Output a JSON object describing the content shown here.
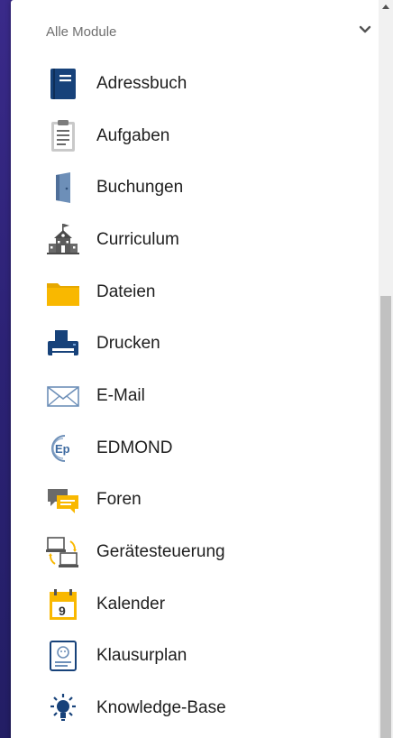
{
  "header": {
    "title": "Alle Module"
  },
  "modules": [
    {
      "label": "Adressbuch",
      "icon": "address-book-icon"
    },
    {
      "label": "Aufgaben",
      "icon": "clipboard-icon"
    },
    {
      "label": "Buchungen",
      "icon": "door-icon"
    },
    {
      "label": "Curriculum",
      "icon": "school-building-icon"
    },
    {
      "label": "Dateien",
      "icon": "folder-icon"
    },
    {
      "label": "Drucken",
      "icon": "printer-icon"
    },
    {
      "label": "E-Mail",
      "icon": "envelope-icon"
    },
    {
      "label": "EDMOND",
      "icon": "edmond-logo-icon"
    },
    {
      "label": "Foren",
      "icon": "chat-bubbles-icon"
    },
    {
      "label": "Gerätesteuerung",
      "icon": "device-control-icon"
    },
    {
      "label": "Kalender",
      "icon": "calendar-icon"
    },
    {
      "label": "Klausurplan",
      "icon": "exam-plan-icon"
    },
    {
      "label": "Knowledge-Base",
      "icon": "lightbulb-icon"
    }
  ],
  "calendar_icon_day": "9",
  "edmond_logo_text": "Ep",
  "colors": {
    "navy": "#17427a",
    "folder_yellow": "#f9b800",
    "steel_blue": "#6d8fb8",
    "text": "#1e1e1e",
    "header_text": "#6f6f6f"
  }
}
